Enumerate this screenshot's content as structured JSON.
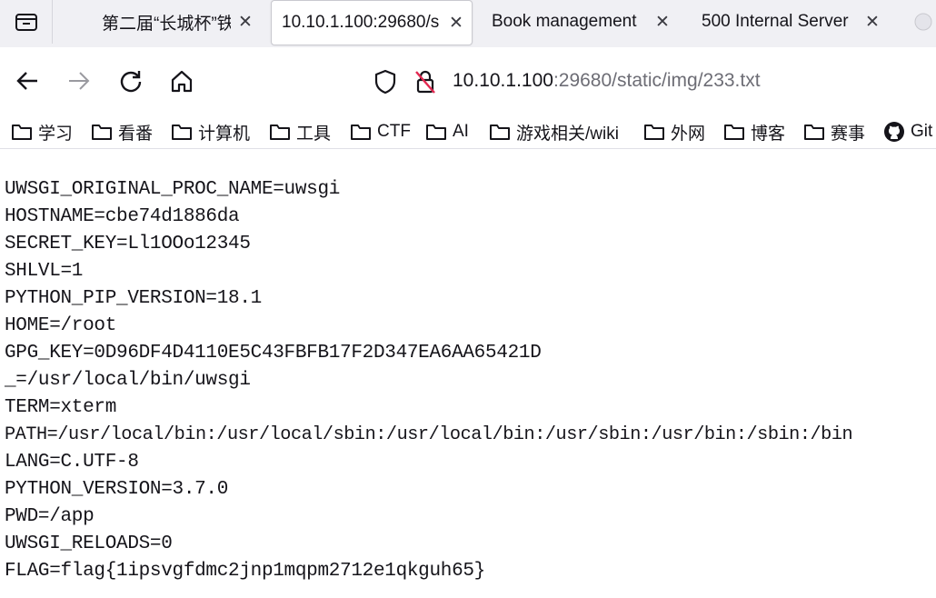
{
  "tabs": [
    {
      "title": "第二届“长城杯”铁",
      "active": false
    },
    {
      "title": "10.10.1.100:29680/s",
      "active": true
    },
    {
      "title": "Book management",
      "active": false
    },
    {
      "title": "500 Internal Server",
      "active": false
    }
  ],
  "navbar": {
    "url_host": "10.10.1.100",
    "url_rest": ":29680/static/img/233.txt"
  },
  "bookmarks": [
    {
      "label": "学习",
      "icon": "folder-icon"
    },
    {
      "label": "看番",
      "icon": "folder-icon"
    },
    {
      "label": "计算机",
      "icon": "folder-icon"
    },
    {
      "label": "工具",
      "icon": "folder-icon"
    },
    {
      "label": "CTF",
      "icon": "folder-icon"
    },
    {
      "label": "AI",
      "icon": "folder-icon"
    },
    {
      "label": "游戏相关/wiki",
      "icon": "folder-icon"
    },
    {
      "label": "外网",
      "icon": "folder-icon"
    },
    {
      "label": "博客",
      "icon": "folder-icon"
    },
    {
      "label": "赛事",
      "icon": "folder-icon"
    },
    {
      "label": "Git",
      "icon": "github-icon"
    }
  ],
  "content": {
    "lines": [
      "UWSGI_ORIGINAL_PROC_NAME=uwsgi",
      "HOSTNAME=cbe74d1886da",
      "SECRET_KEY=Ll1OOo12345",
      "SHLVL=1",
      "PYTHON_PIP_VERSION=18.1",
      "HOME=/root",
      "GPG_KEY=0D96DF4D4110E5C43FBFB17F2D347EA6AA65421D",
      "_=/usr/local/bin/uwsgi",
      "TERM=xterm",
      "PATH=/usr/local/bin:/usr/local/sbin:/usr/local/bin:/usr/sbin:/usr/bin:/sbin:/bin",
      "LANG=C.UTF-8",
      "PYTHON_VERSION=3.7.0",
      "PWD=/app",
      "UWSGI_RELOADS=0",
      "FLAG=flag{1ipsvgfdmc2jnp1mqpm2712e1qkguh65}"
    ]
  }
}
